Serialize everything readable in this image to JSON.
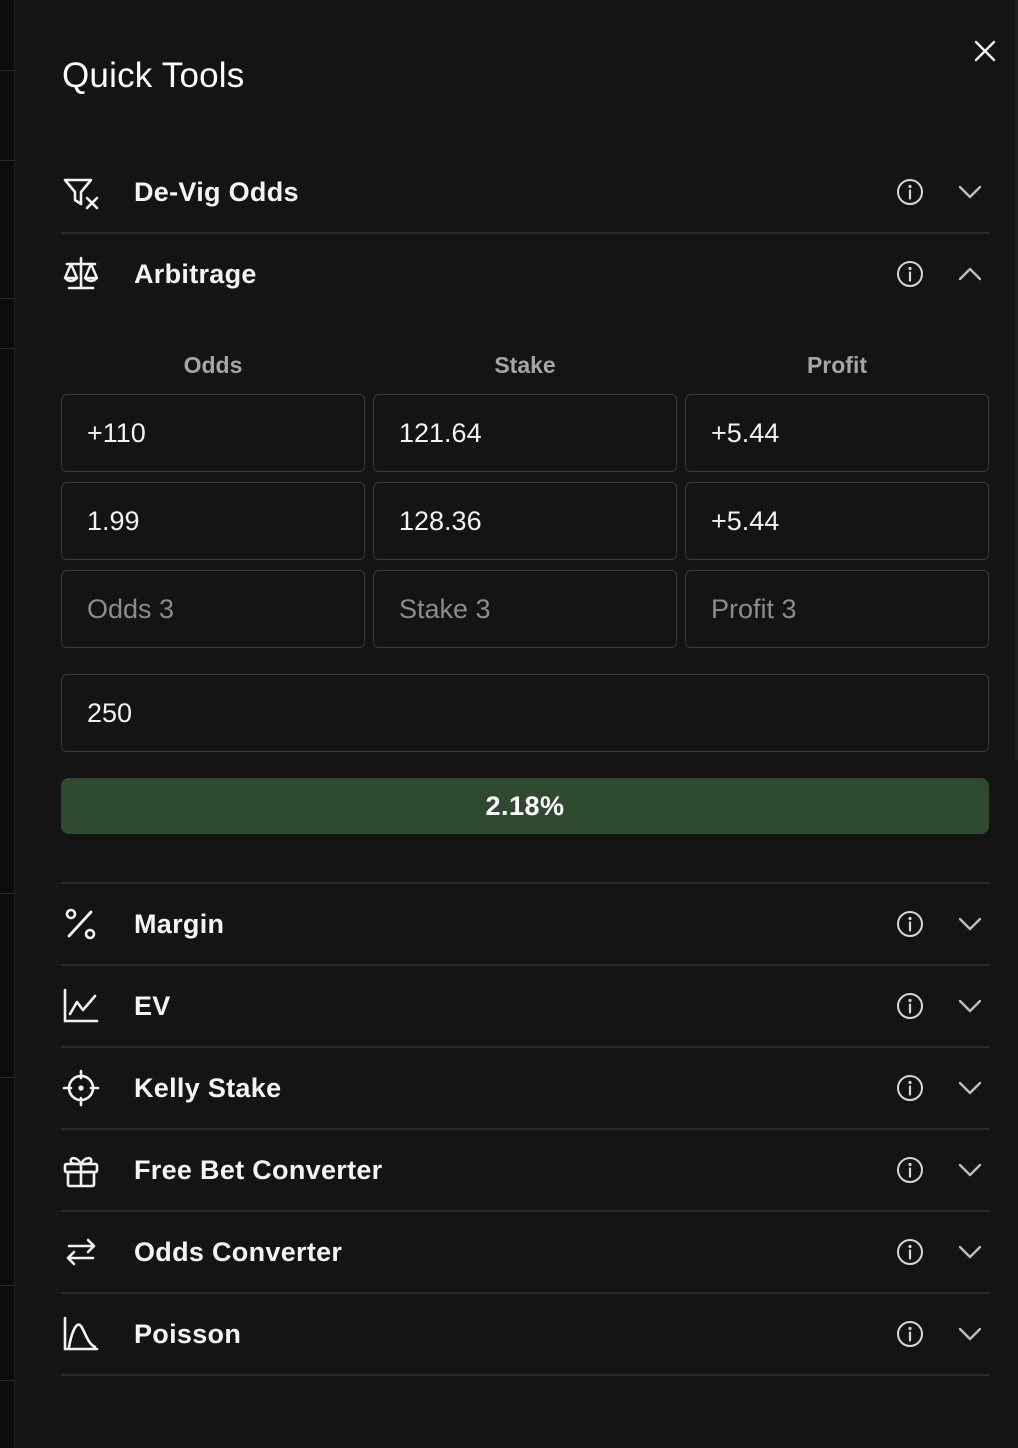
{
  "panel": {
    "title": "Quick Tools"
  },
  "tools": [
    {
      "label": "De-Vig Odds",
      "icon": "filter-x-icon",
      "expanded": false
    },
    {
      "label": "Arbitrage",
      "icon": "scale-icon",
      "expanded": true
    },
    {
      "label": "Margin",
      "icon": "percent-icon",
      "expanded": false
    },
    {
      "label": "EV",
      "icon": "line-chart-icon",
      "expanded": false
    },
    {
      "label": "Kelly Stake",
      "icon": "crosshair-icon",
      "expanded": false
    },
    {
      "label": "Free Bet Converter",
      "icon": "gift-icon",
      "expanded": false
    },
    {
      "label": "Odds Converter",
      "icon": "arrows-swap-icon",
      "expanded": false
    },
    {
      "label": "Poisson",
      "icon": "distribution-curve-icon",
      "expanded": false
    }
  ],
  "arbitrage": {
    "headers": {
      "odds": "Odds",
      "stake": "Stake",
      "profit": "Profit"
    },
    "rows": [
      {
        "odds": "+110",
        "stake": "121.64",
        "profit": "+5.44"
      },
      {
        "odds": "1.99",
        "stake": "128.36",
        "profit": "+5.44"
      }
    ],
    "placeholders": {
      "odds": "Odds 3",
      "stake": "Stake 3",
      "profit": "Profit 3"
    },
    "total_stake": "250",
    "result": "2.18%",
    "result_color": "#2e4b30"
  },
  "colors": {
    "background": "#141414",
    "text": "#f4f4f4",
    "muted": "#a6a6a6",
    "border": "#3a3a3a"
  }
}
